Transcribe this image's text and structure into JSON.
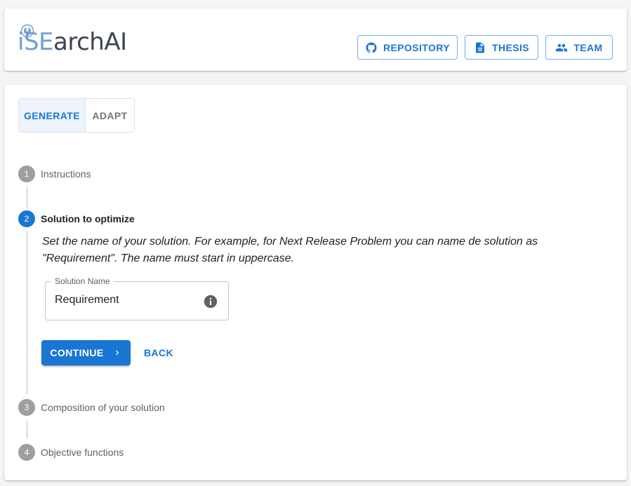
{
  "header": {
    "logo_text_part1": "iSE",
    "logo_text_part2": "archAI",
    "buttons": [
      {
        "label": "REPOSITORY",
        "icon": "github-icon"
      },
      {
        "label": "THESIS",
        "icon": "document-icon"
      },
      {
        "label": "TEAM",
        "icon": "team-icon"
      }
    ]
  },
  "mode_toggle": {
    "options": [
      "GENERATE",
      "ADAPT"
    ],
    "selected": "GENERATE"
  },
  "stepper": {
    "steps": [
      {
        "number": "1",
        "label": "Instructions",
        "status": "inactive"
      },
      {
        "number": "2",
        "label": "Solution to optimize",
        "status": "active"
      },
      {
        "number": "3",
        "label": "Composition of your solution",
        "status": "inactive"
      },
      {
        "number": "4",
        "label": "Objective functions",
        "status": "inactive"
      }
    ],
    "active_step": {
      "description": "Set the name of your solution. For example, for Next Release Problem you can name de solution as \"Requirement\". The name must start in uppercase.",
      "field_label": "Solution Name",
      "field_value": "Requirement",
      "continue_label": "CONTINUE",
      "back_label": "BACK"
    }
  },
  "colors": {
    "primary": "#1976d2",
    "inactive_step": "#9e9e9e",
    "logo_light": "#6f9fd2",
    "logo_dark": "#3e4450"
  }
}
